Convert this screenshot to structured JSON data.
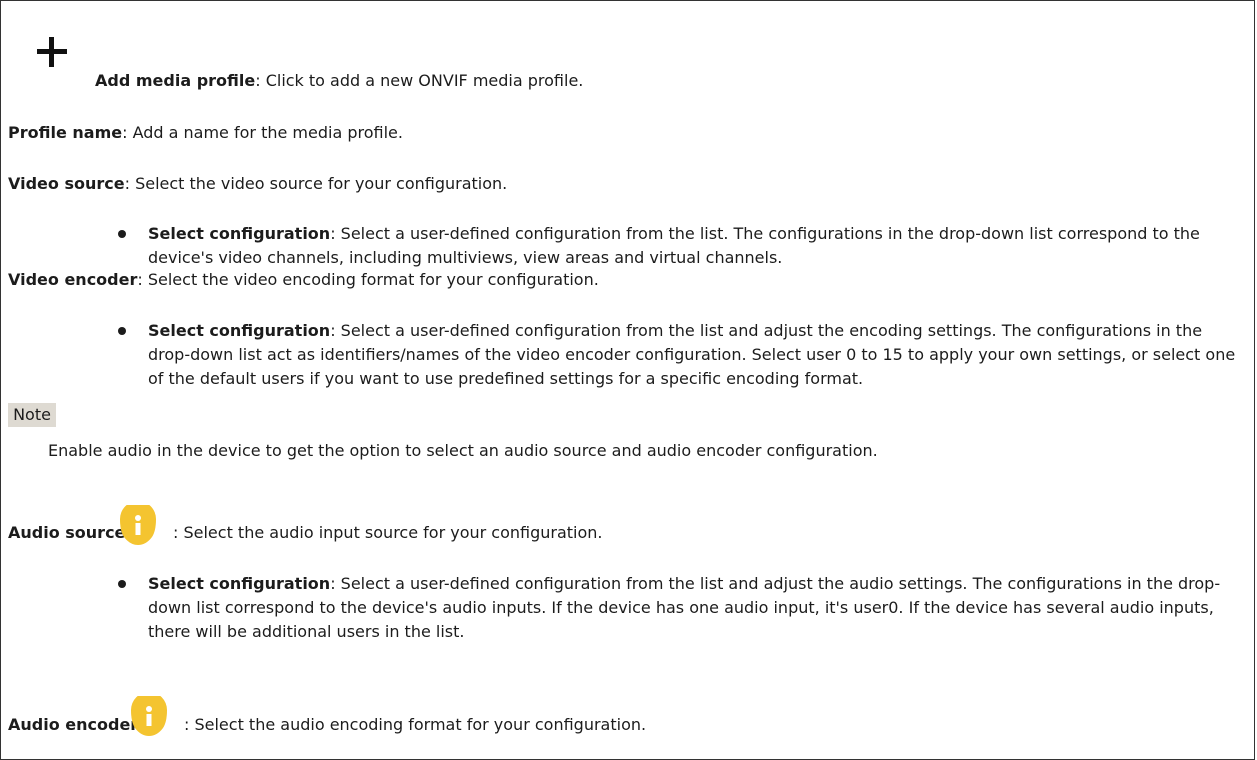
{
  "add_profile": {
    "icon": "plus-icon",
    "label": "Add media profile",
    "text": ": Click to add a new ONVIF media profile."
  },
  "profile_name": {
    "label": "Profile name",
    "text": ": Add a name for the media profile."
  },
  "video_source": {
    "label": "Video source",
    "text": ": Select the video source for your configuration.",
    "bullet_label": "Select configuration",
    "bullet_text": ": Select a user-defined configuration from the list. The configurations in the drop-down list correspond to the device's video channels, including multiviews, view areas and virtual channels."
  },
  "video_encoder": {
    "label": "Video encoder",
    "text": ": Select the video encoding format for your configuration.",
    "bullet_label": "Select configuration",
    "bullet_text": ": Select a user-defined configuration from the list and adjust the encoding settings. The configurations in the drop-down list act as identifiers/names of the video encoder configuration. Select user 0 to 15 to apply your own settings, or select one of the default users if you want to use predefined settings for a specific encoding format."
  },
  "note": {
    "label": "Note",
    "text": "Enable audio in the device to get the option to select an audio source and audio encoder configuration."
  },
  "audio_source": {
    "label": "Audio source",
    "icon": "info-icon",
    "text": ": Select the audio input source for your configuration.",
    "bullet_label": "Select configuration",
    "bullet_text": ": Select a user-defined configuration from the list and adjust the audio settings. The configurations in the drop-down list correspond to the device's audio inputs. If the device has one audio input, it's user0. If the device has several audio inputs, there will be additional users in the list."
  },
  "audio_encoder": {
    "label": "Audio encoder",
    "icon": "info-icon",
    "text": ": Select the audio encoding format for your configuration."
  },
  "colors": {
    "info_icon": "#f4c430",
    "note_background": "#dedad2",
    "text": "#1c1c1c"
  }
}
